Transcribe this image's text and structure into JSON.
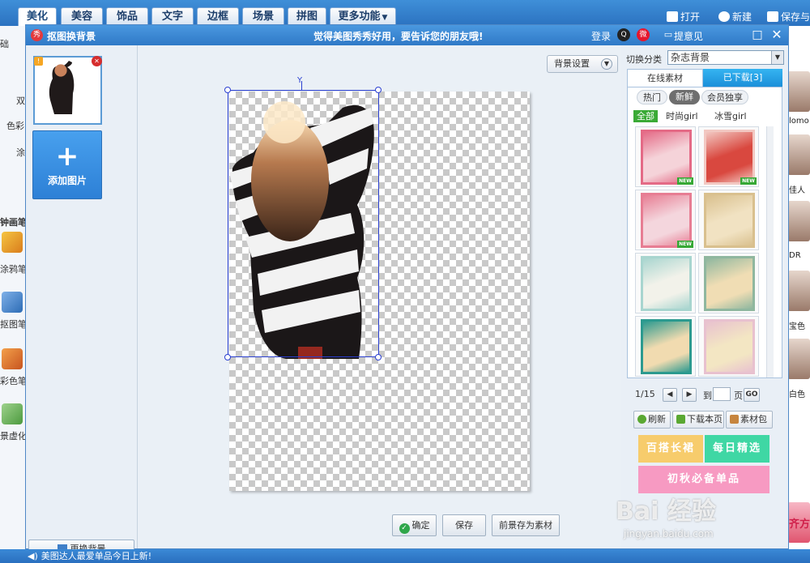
{
  "app": {
    "tabs": [
      {
        "label": "美化"
      },
      {
        "label": "美容"
      },
      {
        "label": "饰品"
      },
      {
        "label": "文字"
      },
      {
        "label": "边框"
      },
      {
        "label": "场景"
      },
      {
        "label": "拼图"
      },
      {
        "label": "更多功能"
      }
    ],
    "actions": {
      "open": "打开",
      "new": "新建",
      "save_share": "保存与"
    }
  },
  "background_left": {
    "labels": [
      "础",
      "双",
      "色彩",
      "涂",
      "钟画笔",
      "涂鸦笔",
      "抠图笔",
      "彩色笔",
      "景虚化"
    ]
  },
  "background_right": {
    "labels": [
      "lomo",
      "佳人",
      "DR",
      "宝色",
      "白色",
      "齐方"
    ]
  },
  "dialog": {
    "title": "抠图换背景",
    "marquee": "觉得美图秀秀好用，要告诉您的朋友哦!",
    "login": "登录",
    "feedback": "提意见",
    "add_image": "添加图片",
    "change_bg": "更换背景",
    "bg_settings": "背景设置",
    "confirm": "确定",
    "save": "保存",
    "save_foreground": "前景存为素材"
  },
  "material_panel": {
    "switch_label": "切换分类",
    "category_value": "杂志背景",
    "tabs": {
      "online": "在线素材",
      "downloaded": "已下载[3]"
    },
    "filters": [
      "热门",
      "新鲜",
      "会员独享"
    ],
    "subfilters": [
      "全部",
      "时尚girl",
      "冰雪girl"
    ],
    "items": [
      {
        "new": true,
        "colors": [
          "#e46a86",
          "#f5d3d9"
        ]
      },
      {
        "new": true,
        "colors": [
          "#f2c8c2",
          "#d9483f"
        ]
      },
      {
        "new": true,
        "colors": [
          "#e77d93",
          "#f4d6dd"
        ]
      },
      {
        "new": false,
        "colors": [
          "#d9c08e",
          "#f1e2c2"
        ]
      },
      {
        "new": false,
        "colors": [
          "#a8d5cf",
          "#f2f2ea"
        ]
      },
      {
        "new": false,
        "colors": [
          "#8fb79f",
          "#f0ddb4"
        ]
      },
      {
        "new": false,
        "colors": [
          "#2c9a8f",
          "#f1dbb0"
        ]
      },
      {
        "new": false,
        "colors": [
          "#e8c1cf",
          "#f3e6c3"
        ]
      }
    ],
    "pagination": {
      "current": "1/15",
      "goto": "到",
      "page_unit": "页",
      "go": "GO"
    },
    "refresh": "刷新",
    "download_page": "下载本页",
    "material_pack": "素材包",
    "banners": [
      "百搭长裙",
      "每日精选",
      "初秋必备单品"
    ]
  },
  "statusbar": {
    "text": "美图达人最爱单品今日上新!"
  },
  "watermark": {
    "main": "Bai 经验",
    "sub": "jingyan.baidu.com"
  }
}
